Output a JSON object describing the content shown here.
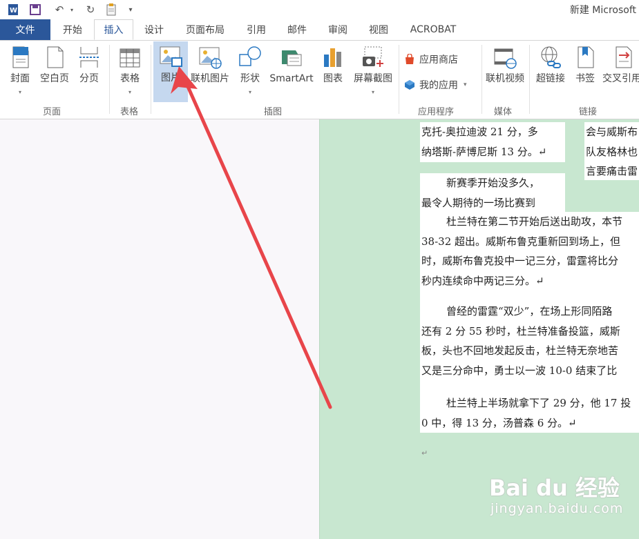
{
  "title_bar": {
    "title": "新建 Microsoft",
    "app_icon": "word-icon",
    "save_icon": "save-icon",
    "undo_icon": "undo-icon",
    "redo_icon": "redo-icon",
    "clipboard_icon": "clipboard-icon",
    "customize_icon": "customize-quick-access-icon"
  },
  "tabs": [
    "文件",
    "开始",
    "插入",
    "设计",
    "页面布局",
    "引用",
    "邮件",
    "审阅",
    "视图",
    "ACROBAT"
  ],
  "active_tab": "插入",
  "ribbon": {
    "pages_group": {
      "label": "页面",
      "cover": "封面",
      "blank_page": "空白页",
      "page_break": "分页"
    },
    "tables_group": {
      "label": "表格",
      "table": "表格"
    },
    "illustrations_group": {
      "label": "插图",
      "picture": "图片",
      "online_picture": "联机图片",
      "shapes": "形状",
      "smartart": "SmartArt",
      "chart": "图表",
      "screenshot": "屏幕截图"
    },
    "apps_group": {
      "label": "应用程序",
      "store": "应用商店",
      "my_apps": "我的应用"
    },
    "media_group": {
      "label": "媒体",
      "online_video": "联机视频"
    },
    "links_group": {
      "label": "链接",
      "hyperlink": "超链接",
      "bookmark": "书签",
      "cross_reference": "交叉引用"
    }
  },
  "document": {
    "block1": [
      "克托-奥拉迪波 21 分，多",
      "纳塔斯-萨博尼斯 13 分。↵"
    ],
    "block2": [
      "会与威斯布",
      "队友格林也",
      "言要痛击雷"
    ],
    "block3": [
      "新赛季开始没多久，",
      "最令人期待的一场比赛到"
    ],
    "block4": [
      "杜兰特在第二节开始后送出助攻，本节",
      "38-32 超出。威斯布鲁克重新回到场上，但",
      "时，威斯布鲁克投中一记三分，雷霆将比分",
      "秒内连续命中两记三分。↵"
    ],
    "block5": [
      "曾经的雷霆“双少”，在场上形同陌路",
      "还有 2 分 55 秒时，杜兰特准备投篮，威斯",
      "板，头也不回地发起反击，杜兰特无奈地苦",
      "又是三分命中，勇士以一波 10-0 结束了比"
    ],
    "block6": [
      "杜兰特上半场就拿下了 29 分，他 17 投",
      "0 中，得 13 分，汤普森 6 分。↵"
    ],
    "trailing_mark": "↵"
  },
  "watermark": {
    "brand": "Bai du 经验",
    "site": "jingyan.baidu.com"
  },
  "colors": {
    "file_tab": "#2b579a",
    "doc_green": "#c8e7d0",
    "arrow": "#e8454a",
    "selected_button": "#c5d8ef"
  }
}
